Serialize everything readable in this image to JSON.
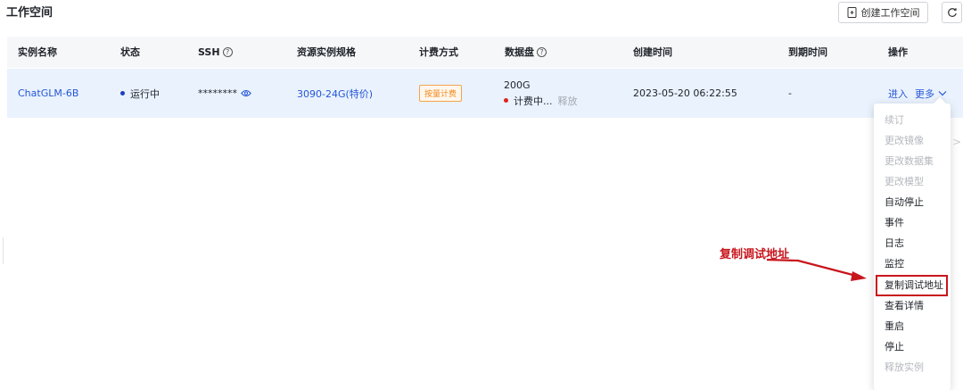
{
  "header": {
    "title": "工作空间",
    "create_button_label": "创建工作空间"
  },
  "table": {
    "columns": [
      "实例名称",
      "状态",
      "SSH",
      "资源实例规格",
      "计费方式",
      "数据盘",
      "创建时间",
      "到期时间",
      "操作"
    ],
    "row": {
      "name": "ChatGLM-6B",
      "status": "运行中",
      "ssh": "********",
      "spec": "3090-24G(特价)",
      "billing": "按量计费",
      "disk_size": "200G",
      "disk_status": "计费中...",
      "disk_release": "释放",
      "created": "2023-05-20 06:22:55",
      "expires": "-",
      "action_enter": "进入",
      "action_more": "更多"
    }
  },
  "menu": {
    "items": [
      {
        "label": "续订",
        "disabled": true
      },
      {
        "label": "更改镜像",
        "disabled": true
      },
      {
        "label": "更改数据集",
        "disabled": true
      },
      {
        "label": "更改模型",
        "disabled": true
      },
      {
        "label": "自动停止",
        "disabled": false
      },
      {
        "label": "事件",
        "disabled": false
      },
      {
        "label": "日志",
        "disabled": false
      },
      {
        "label": "监控",
        "disabled": false
      },
      {
        "label": "复制调试地址",
        "disabled": false,
        "highlighted": true
      },
      {
        "label": "查看详情",
        "disabled": false
      },
      {
        "label": "重启",
        "disabled": false
      },
      {
        "label": "停止",
        "disabled": false
      },
      {
        "label": "释放实例",
        "disabled": true
      }
    ]
  },
  "annotation": {
    "text": "复制调试地址",
    "color": "#c8161d"
  },
  "colors": {
    "link": "#2456d6",
    "row_highlight": "#eaf2fe",
    "header_bg": "#f6f7f9",
    "billing_tag": "#f08a1c",
    "disk_status_dot": "#e0211b"
  }
}
